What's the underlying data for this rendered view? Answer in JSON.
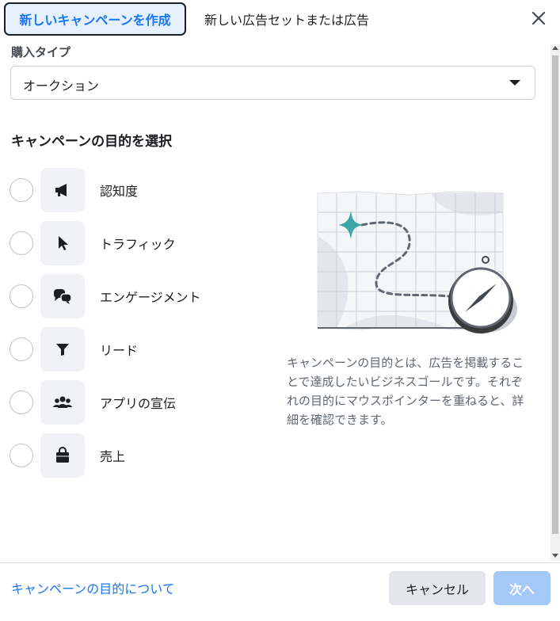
{
  "tabs": {
    "active_label": "新しいキャンペーンを作成",
    "inactive_label": "新しい広告セットまたは広告"
  },
  "icons": {
    "close": "close-icon",
    "caret": "chevron-down-icon"
  },
  "purchase": {
    "label": "購入タイプ",
    "value": "オークション"
  },
  "objectives": {
    "title": "キャンペーンの目的を選択",
    "items": [
      {
        "label": "認知度",
        "icon": "megaphone-icon"
      },
      {
        "label": "トラフィック",
        "icon": "cursor-icon"
      },
      {
        "label": "エンゲージメント",
        "icon": "chat-bubbles-icon"
      },
      {
        "label": "リード",
        "icon": "funnel-icon"
      },
      {
        "label": "アプリの宣伝",
        "icon": "people-icon"
      },
      {
        "label": "売上",
        "icon": "shopping-bag-icon"
      }
    ]
  },
  "description": "キャンペーンの目的とは、広告を掲載することで達成したいビジネスゴールです。それぞれの目的にマウスポインターを重ねると、詳細を確認できます。",
  "footer": {
    "link": "キャンペーンの目的について",
    "cancel": "キャンセル",
    "next": "次へ"
  },
  "colors": {
    "accent": "#1877f2",
    "tab_bg": "#e7f0fd",
    "next_disabled": "#a4c8f8",
    "map_teal": "#3ba7a6"
  }
}
